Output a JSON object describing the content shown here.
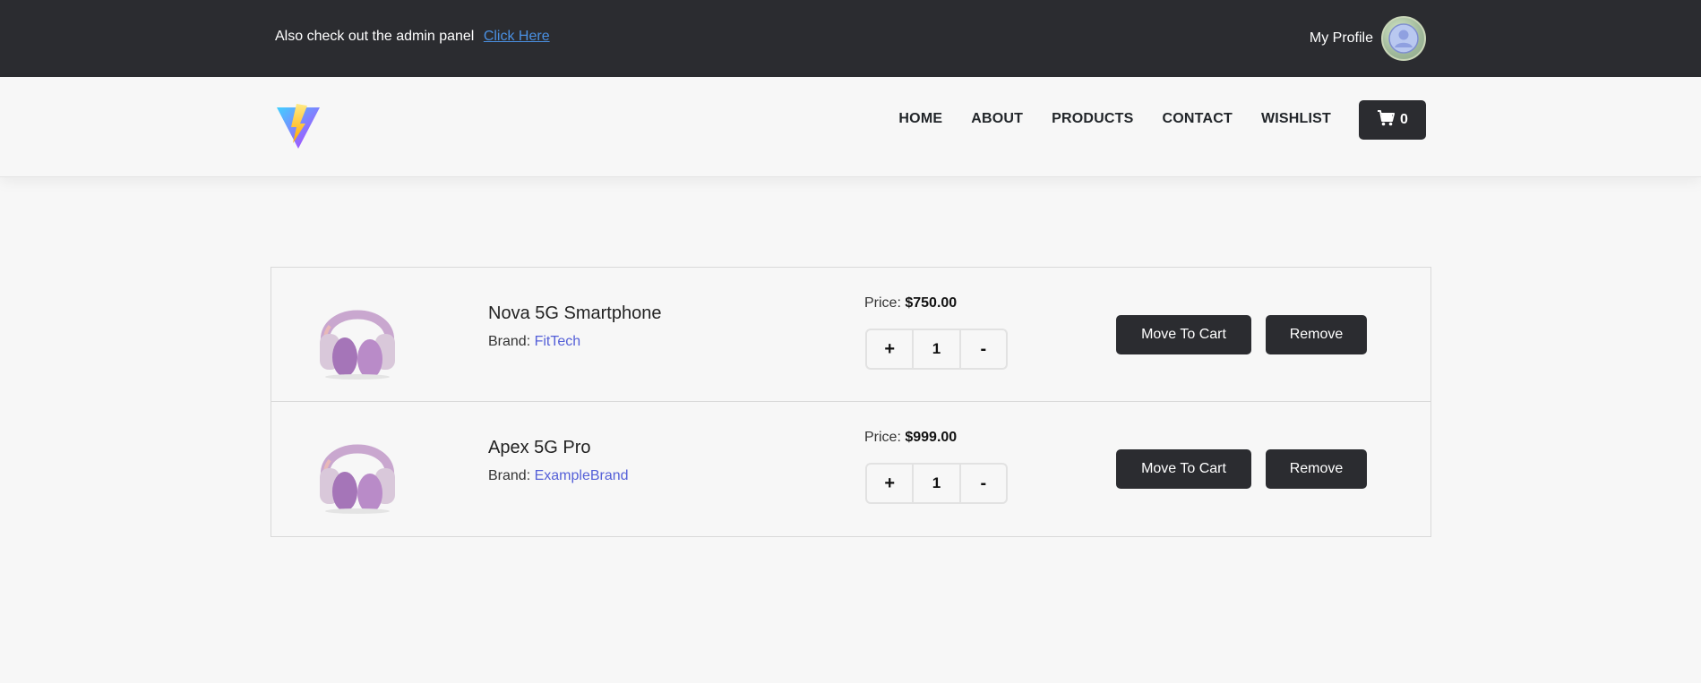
{
  "topbar": {
    "promo_text": "Also check out the admin panel",
    "promo_link": "Click Here",
    "profile_label": "My Profile"
  },
  "navbar": {
    "links": [
      "HOME",
      "ABOUT",
      "PRODUCTS",
      "CONTACT",
      "WISHLIST"
    ],
    "cart_count": "0"
  },
  "wishlist": {
    "items": [
      {
        "name": "Nova 5G Smartphone",
        "brand_label": "Brand:",
        "brand": "FitTech",
        "price_label": "Price:",
        "price": "$750.00",
        "qty_plus": "+",
        "quantity": "1",
        "qty_minus": "-",
        "move_label": "Move To Cart",
        "remove_label": "Remove"
      },
      {
        "name": "Apex 5G Pro",
        "brand_label": "Brand:",
        "brand": "ExampleBrand",
        "price_label": "Price:",
        "price": "$999.00",
        "qty_plus": "+",
        "quantity": "1",
        "qty_minus": "-",
        "move_label": "Move To Cart",
        "remove_label": "Remove"
      }
    ]
  },
  "colors": {
    "dark": "#2b2c30",
    "link": "#4a90e2",
    "brand": "#5560d8",
    "background": "#f7f7f7"
  },
  "icons": {
    "logo": "vite-logo-icon",
    "cart": "cart-icon",
    "avatar": "user-avatar-icon",
    "product": "headphones-image"
  }
}
